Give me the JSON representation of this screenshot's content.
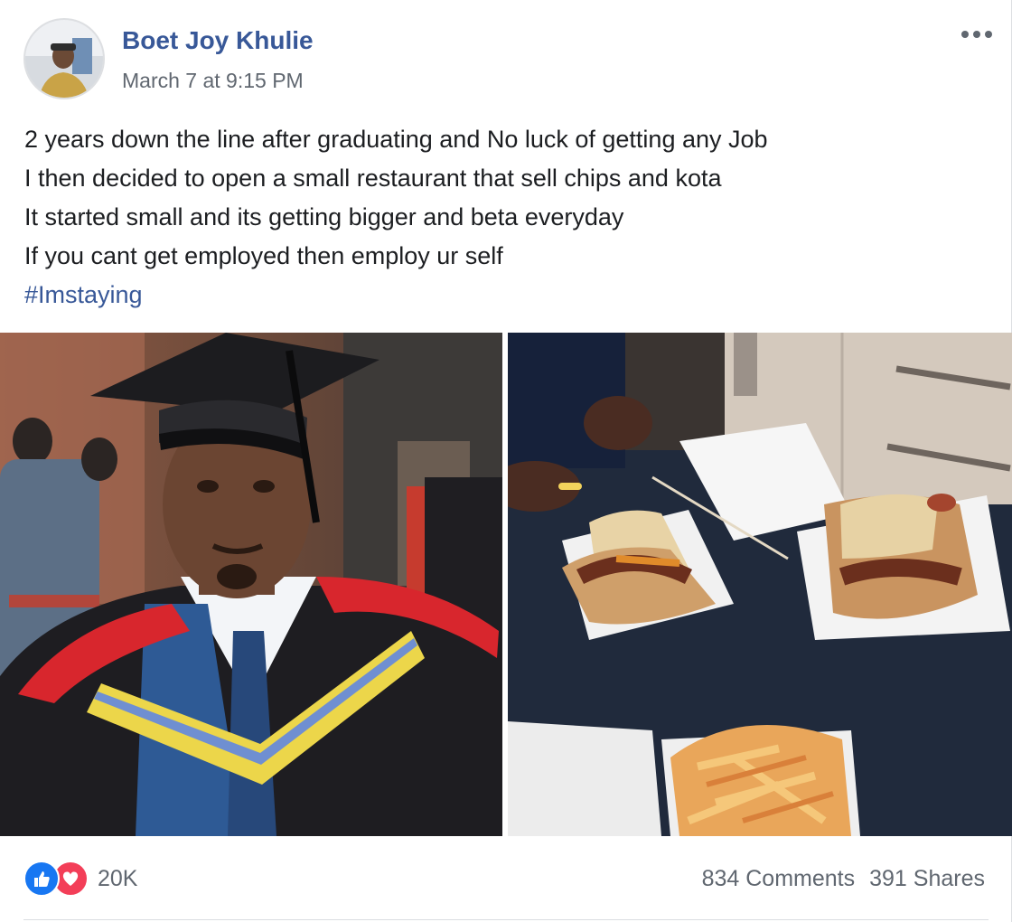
{
  "post": {
    "author": "Boet Joy Khulie",
    "timestamp": "March 7 at 9:15 PM",
    "more_icon": "more-options-icon",
    "lines": [
      "2 years down the line after graduating and No luck of getting any Job",
      "I then decided to open a small restaurant that sell chips and kota",
      "It started small and its getting bigger and beta everyday",
      "If you cant get employed then employ ur self"
    ],
    "hashtag": "#Imstaying"
  },
  "reactions": {
    "count": "20K",
    "icons": [
      "like-icon",
      "love-icon"
    ],
    "like_color": "#1877f2",
    "love_color": "#f33e58"
  },
  "stats": {
    "comments": "834 Comments",
    "shares": "391 Shares"
  },
  "colors": {
    "link": "#385898",
    "meta": "#606770"
  }
}
